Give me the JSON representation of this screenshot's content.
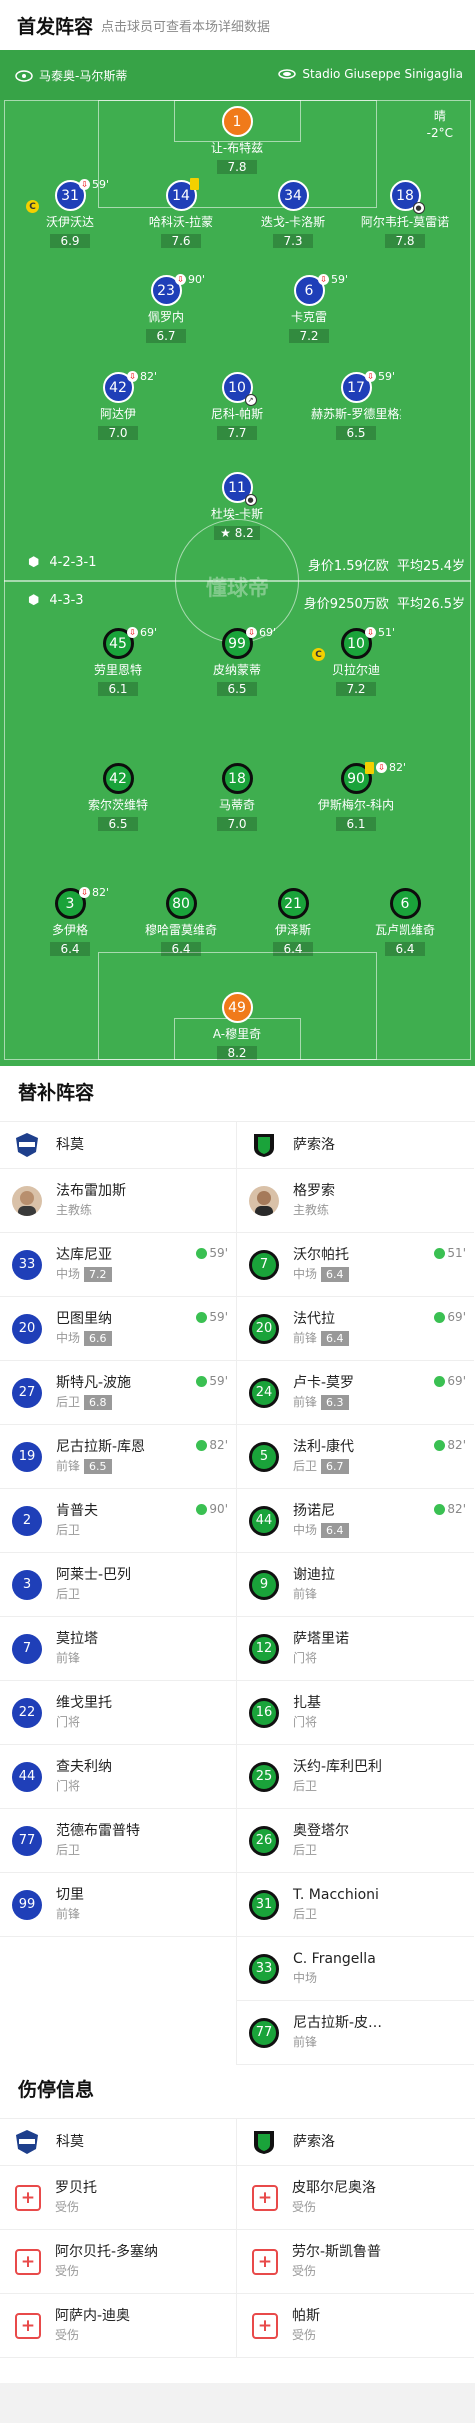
{
  "header": {
    "title": "首发阵容",
    "subtitle": "点击球员可查看本场详细数据"
  },
  "match": {
    "home_team": "马泰奥-马尔斯蒂",
    "venue": "Stadio Giuseppe Sinigaglia",
    "weather": "晴",
    "temperature": "-2°C"
  },
  "home_formation": {
    "formation": "4-2-3-1",
    "value": "身价1.59亿欧",
    "avg_age": "平均25.4岁"
  },
  "away_formation": {
    "formation": "4-3-3",
    "value": "身价9250万欧",
    "avg_age": "平均26.5岁"
  },
  "watermark": "懂球帝",
  "home_players": [
    {
      "number": "1",
      "name": "让-布特兹",
      "rating": "7.8"
    },
    {
      "number": "31",
      "name": "沃伊沃达",
      "rating": "6.9",
      "sub_time": "59'"
    },
    {
      "number": "14",
      "name": "哈科沃-拉蒙",
      "rating": "7.6"
    },
    {
      "number": "34",
      "name": "迭戈-卡洛斯",
      "rating": "7.3"
    },
    {
      "number": "18",
      "name": "阿尔韦托-莫雷诺",
      "rating": "7.8"
    },
    {
      "number": "23",
      "name": "佩罗内",
      "rating": "6.7",
      "sub_time": "90'"
    },
    {
      "number": "6",
      "name": "卡克雷",
      "rating": "7.2",
      "sub_time": "59'"
    },
    {
      "number": "42",
      "name": "阿达伊",
      "rating": "7.0",
      "sub_time": "82'"
    },
    {
      "number": "10",
      "name": "尼科-帕斯",
      "rating": "7.7"
    },
    {
      "number": "17",
      "name": "赫苏斯-罗德里格斯",
      "rating": "6.5",
      "sub_time": "59'"
    },
    {
      "number": "11",
      "name": "杜埃-卡斯",
      "rating": "8.2"
    }
  ],
  "away_players": [
    {
      "number": "45",
      "name": "劳里恩特",
      "rating": "6.1",
      "sub_time": "69'"
    },
    {
      "number": "99",
      "name": "皮纳蒙蒂",
      "rating": "6.5",
      "sub_time": "69'"
    },
    {
      "number": "10",
      "name": "贝拉尔迪",
      "rating": "7.2",
      "sub_time": "51'"
    },
    {
      "number": "42",
      "name": "索尔茨维特",
      "rating": "6.5"
    },
    {
      "number": "18",
      "name": "马蒂奇",
      "rating": "7.0"
    },
    {
      "number": "90",
      "name": "伊斯梅尔-科内",
      "rating": "6.1",
      "sub_time": "82'"
    },
    {
      "number": "3",
      "name": "多伊格",
      "rating": "6.4",
      "sub_time": "82'"
    },
    {
      "number": "80",
      "name": "穆哈雷莫维奇",
      "rating": "6.4"
    },
    {
      "number": "21",
      "name": "伊泽斯",
      "rating": "6.4"
    },
    {
      "number": "6",
      "name": "瓦卢凯维奇",
      "rating": "6.4"
    },
    {
      "number": "49",
      "name": "A-穆里奇",
      "rating": "8.2"
    }
  ],
  "subs_title": "替补阵容",
  "home_team_name": "科莫",
  "away_team_name": "萨索洛",
  "home_coach": {
    "name": "法布雷加斯",
    "role": "主教练"
  },
  "away_coach": {
    "name": "格罗索",
    "role": "主教练"
  },
  "home_subs": [
    {
      "number": "33",
      "name": "达库尼亚",
      "position": "中场",
      "rating": "7.2",
      "time": "59'"
    },
    {
      "number": "20",
      "name": "巴图里纳",
      "position": "中场",
      "rating": "6.6",
      "time": "59'"
    },
    {
      "number": "27",
      "name": "斯特凡-波施",
      "position": "后卫",
      "rating": "6.8",
      "time": "59'"
    },
    {
      "number": "19",
      "name": "尼古拉斯-库恩",
      "position": "前锋",
      "rating": "6.5",
      "time": "82'"
    },
    {
      "number": "2",
      "name": "肯普夫",
      "position": "后卫",
      "time": "90'"
    },
    {
      "number": "3",
      "name": "阿莱士-巴列",
      "position": "后卫"
    },
    {
      "number": "7",
      "name": "莫拉塔",
      "position": "前锋"
    },
    {
      "number": "22",
      "name": "维戈里托",
      "position": "门将"
    },
    {
      "number": "44",
      "name": "查夫利纳",
      "position": "门将"
    },
    {
      "number": "77",
      "name": "范德布雷普特",
      "position": "后卫"
    },
    {
      "number": "99",
      "name": "切里",
      "position": "前锋"
    }
  ],
  "away_subs": [
    {
      "number": "7",
      "name": "沃尔帕托",
      "position": "中场",
      "rating": "6.4",
      "time": "51'"
    },
    {
      "number": "20",
      "name": "法代拉",
      "position": "前锋",
      "rating": "6.4",
      "time": "69'"
    },
    {
      "number": "24",
      "name": "卢卡-莫罗",
      "position": "前锋",
      "rating": "6.3",
      "time": "69'"
    },
    {
      "number": "5",
      "name": "法利-康代",
      "position": "后卫",
      "rating": "6.7",
      "time": "82'"
    },
    {
      "number": "44",
      "name": "扬诺尼",
      "position": "中场",
      "rating": "6.4",
      "time": "82'"
    },
    {
      "number": "9",
      "name": "谢迪拉",
      "position": "前锋"
    },
    {
      "number": "12",
      "name": "萨塔里诺",
      "position": "门将"
    },
    {
      "number": "16",
      "name": "扎基",
      "position": "门将"
    },
    {
      "number": "25",
      "name": "沃约-库利巴利",
      "position": "后卫"
    },
    {
      "number": "26",
      "name": "奥登塔尔",
      "position": "后卫"
    },
    {
      "number": "31",
      "name": "T. Macchioni",
      "position": "后卫"
    },
    {
      "number": "33",
      "name": "C. Frangella",
      "position": "中场"
    },
    {
      "number": "77",
      "name": "尼古拉斯-皮…",
      "position": "前锋"
    }
  ],
  "injury_title": "伤停信息",
  "home_injuries": [
    {
      "name": "罗贝托",
      "status": "受伤"
    },
    {
      "name": "阿尔贝托-多塞纳",
      "status": "受伤"
    },
    {
      "name": "阿萨内-迪奥",
      "status": "受伤"
    }
  ],
  "away_injuries": [
    {
      "name": "皮耶尔尼奥洛",
      "status": "受伤"
    },
    {
      "name": "劳尔-斯凯鲁普",
      "status": "受伤"
    },
    {
      "name": "帕斯",
      "status": "受伤"
    }
  ],
  "colors": {
    "pitch": "#3fae4f",
    "home": "#1f3fb8",
    "away": "#1aa33a",
    "goalkeeper": "#f07a1a"
  }
}
